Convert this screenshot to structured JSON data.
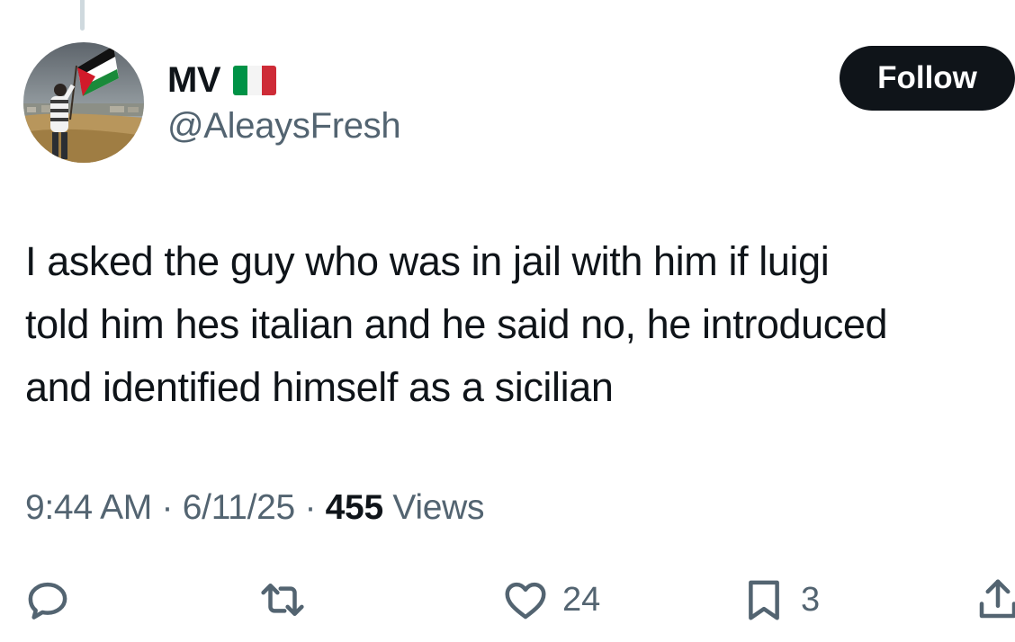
{
  "user": {
    "display_name": "MV",
    "flag_icon": "italy-flag",
    "handle": "@AleaysFresh"
  },
  "follow_label": "Follow",
  "tweet": {
    "lines": [
      "I asked the guy who was in jail with him if luigi",
      "told him hes italian and he said no, he introduced",
      "and identified himself as a sicilian"
    ]
  },
  "meta": {
    "time": "9:44 AM",
    "date": "6/11/25",
    "views_count": "455",
    "views_label": "Views"
  },
  "actions": {
    "reply": {
      "icon": "reply-icon"
    },
    "retweet": {
      "icon": "retweet-icon"
    },
    "like": {
      "icon": "heart-icon",
      "count": "24"
    },
    "bookmark": {
      "icon": "bookmark-icon",
      "count": "3"
    },
    "share": {
      "icon": "share-icon"
    }
  },
  "colors": {
    "text": "#0f1419",
    "secondary": "#536471",
    "follow_bg": "#0f1419"
  }
}
